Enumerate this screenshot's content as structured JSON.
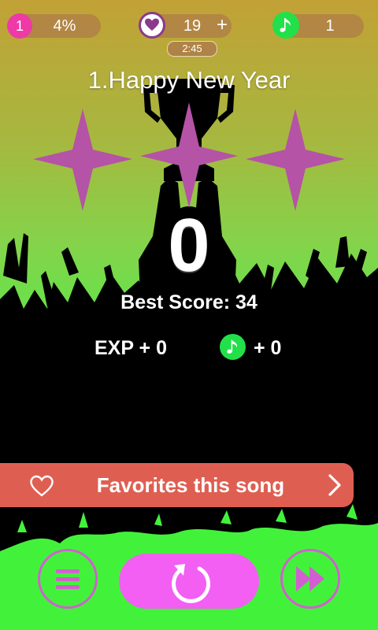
{
  "top_bar": {
    "level": "1",
    "progress": "4%",
    "lives": "19",
    "lives_plus": "+",
    "timer": "2:45",
    "coins": "1"
  },
  "song": {
    "title": "1.Happy New Year"
  },
  "result": {
    "stars_total": 3,
    "stars_earned": 0,
    "score": "0",
    "best_score": "Best Score: 34",
    "exp_gain": "EXP + 0",
    "coin_gain": "+ 0"
  },
  "favorite": {
    "label": "Favorites this song"
  },
  "bottom_bar": {
    "menu_icon": "menu-icon",
    "replay_icon": "replay-icon",
    "next_icon": "fast-forward-icon"
  },
  "colors": {
    "accent_pink": "#ee3aa6",
    "star_magenta": "#b553a6",
    "fav_bar": "#de5f52",
    "coin_green": "#22e04a",
    "replay_button": "#f25ff2"
  }
}
